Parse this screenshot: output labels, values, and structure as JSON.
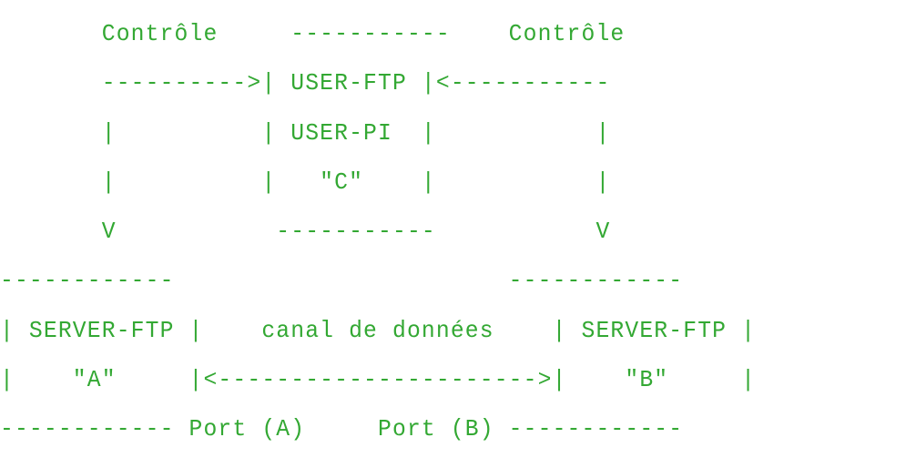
{
  "diagram": {
    "lines": [
      "       Contrôle     -----------    Contrôle",
      "       ---------->| USER-FTP |<-----------",
      "       |          | USER-PI  |           |",
      "       |          |   \"C\"    |           |",
      "       V           -----------           V",
      "------------                       ------------",
      "| SERVER-FTP |    canal de données    | SERVER-FTP |",
      "|    \"A\"     |<---------------------->|    \"B\"     |",
      "------------ Port (A)     Port (B) ------------"
    ]
  },
  "colors": {
    "text": "#33a833",
    "background": "#ffffff"
  }
}
